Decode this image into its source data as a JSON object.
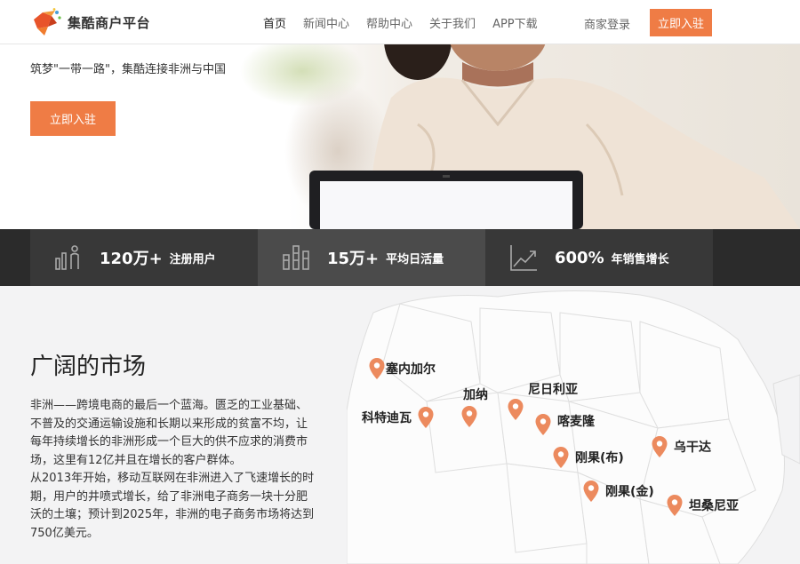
{
  "header": {
    "logo_text": "集酷商户平台",
    "nav": [
      "首页",
      "新闻中心",
      "帮助中心",
      "关于我们",
      "APP下载"
    ],
    "merchant_login": "商家登录",
    "join_label": "立即入驻"
  },
  "hero": {
    "slogan": "筑梦\"一带一路\"，集酷连接非洲与中国",
    "button_label": "立即入驻"
  },
  "stats": [
    {
      "value": "120万+",
      "label": "注册用户",
      "icon": "users-icon"
    },
    {
      "value": "15万+",
      "label": "平均日活量",
      "icon": "bar-chart-icon"
    },
    {
      "value": "600%",
      "label": "年销售增长",
      "icon": "growth-chart-icon"
    }
  ],
  "market": {
    "title": "广阔的市场",
    "paragraphs": [
      "非洲——跨境电商的最后一个蓝海。匮乏的工业基础、不普及的交通运输设施和长期以来形成的贫富不均，让每年持续增长的非洲形成一个巨大的供不应求的消费市场，这里有12亿并且在增长的客户群体。",
      "从2013年开始，移动互联网在非洲进入了飞速增长的时期，用户的井喷式增长，给了非洲电子商务一块十分肥沃的土壤；预计到2025年，非洲的电子商务市场将达到750亿美元。"
    ],
    "countries": [
      "塞内加尔",
      "加纳",
      "尼日利亚",
      "科特迪瓦",
      "喀麦隆",
      "刚果(布)",
      "乌干达",
      "刚果(金)",
      "坦桑尼亚"
    ]
  },
  "colors": {
    "accent": "#ef7c45",
    "stats_bg": "#2b2b2b",
    "pin": "#ec8a5e"
  }
}
